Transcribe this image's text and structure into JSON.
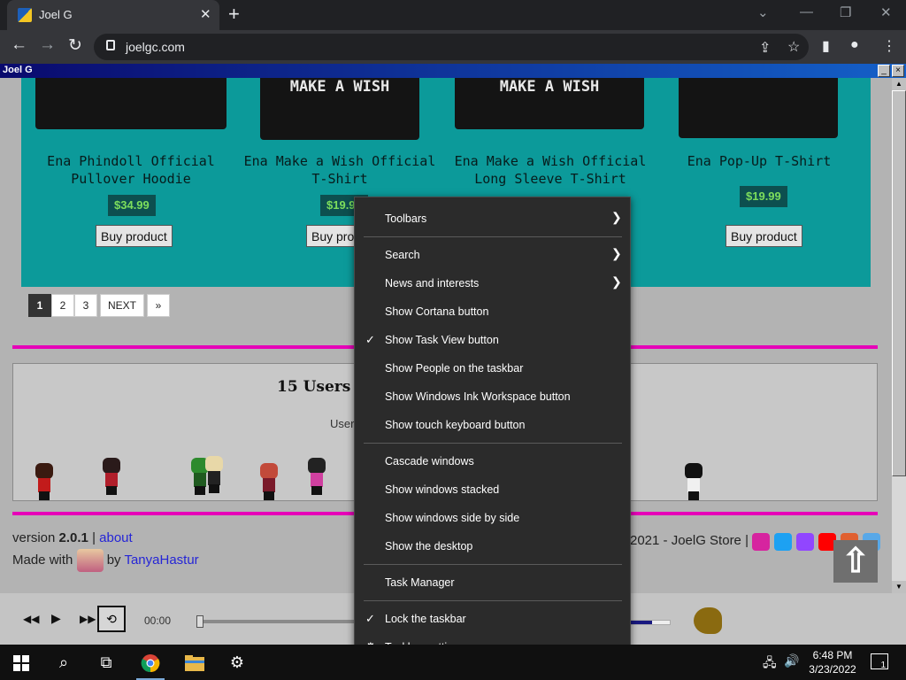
{
  "browser": {
    "tab_title": "Joel G",
    "url": "joelgc.com"
  },
  "site_window": {
    "title": "Joel G",
    "minimize_label": "_",
    "close_label": "×"
  },
  "products": [
    {
      "name_line1": "Ena Phindoll Official",
      "name_line2": "Pullover Hoodie",
      "price": "$34.99",
      "buy_label": "Buy product",
      "shirt_text": ""
    },
    {
      "name_line1": "Ena Make a Wish Official",
      "name_line2": "T-Shirt",
      "price": "$19.99",
      "buy_label": "Buy product",
      "shirt_text": "MAKE A WISH"
    },
    {
      "name_line1": "Ena Make a Wish Official",
      "name_line2": "Long Sleeve T-Shirt",
      "price": "",
      "buy_label": "",
      "shirt_text": "MAKE A WISH"
    },
    {
      "name_line1": "Ena Pop-Up T-Shirt",
      "name_line2": "",
      "price": "$19.99",
      "buy_label": "Buy product",
      "shirt_text": ""
    }
  ],
  "pagination": {
    "pages": [
      "1",
      "2",
      "3"
    ],
    "next_label": "NEXT",
    "last_label": "»",
    "active": "1"
  },
  "users_panel": {
    "heading": "15 Users a",
    "subheading": "User"
  },
  "footer": {
    "version_prefix": "version ",
    "version": "2.0.1",
    "separator": " | ",
    "about_link": "about",
    "made_with": "Made with ",
    "by": " by ",
    "author_link": "TanyaHastur",
    "copyright": "2021 - JoelG Store |"
  },
  "player": {
    "time": "00:00",
    "prev_icon": "rewind-icon",
    "play_icon": "play-icon",
    "next_icon": "fast-forward-icon",
    "loop_icon": "loop-icon"
  },
  "context_menu": {
    "items": [
      {
        "label": "Toolbars",
        "submenu": true,
        "checked": false
      },
      {
        "label": "Search",
        "submenu": true,
        "checked": false
      },
      {
        "label": "News and interests",
        "submenu": true,
        "checked": false
      },
      {
        "label": "Show Cortana button",
        "submenu": false,
        "checked": false
      },
      {
        "label": "Show Task View button",
        "submenu": false,
        "checked": true
      },
      {
        "label": "Show People on the taskbar",
        "submenu": false,
        "checked": false
      },
      {
        "label": "Show Windows Ink Workspace button",
        "submenu": false,
        "checked": false
      },
      {
        "label": "Show touch keyboard button",
        "submenu": false,
        "checked": false
      },
      {
        "label": "Cascade windows",
        "submenu": false,
        "checked": false
      },
      {
        "label": "Show windows stacked",
        "submenu": false,
        "checked": false
      },
      {
        "label": "Show windows side by side",
        "submenu": false,
        "checked": false
      },
      {
        "label": "Show the desktop",
        "submenu": false,
        "checked": false
      },
      {
        "label": "Task Manager",
        "submenu": false,
        "checked": false
      },
      {
        "label": "Lock the taskbar",
        "submenu": false,
        "checked": true
      },
      {
        "label": "Taskbar settings",
        "submenu": false,
        "checked": false,
        "icon": "gear-icon"
      }
    ]
  },
  "taskbar": {
    "time": "6:48 PM",
    "date": "3/23/2022",
    "notification_count": "1"
  },
  "colors": {
    "accent_magenta": "#e600b8",
    "teal_panel": "#0c9a9a",
    "price_green": "#7dde5c",
    "link_blue": "#2525d6"
  }
}
